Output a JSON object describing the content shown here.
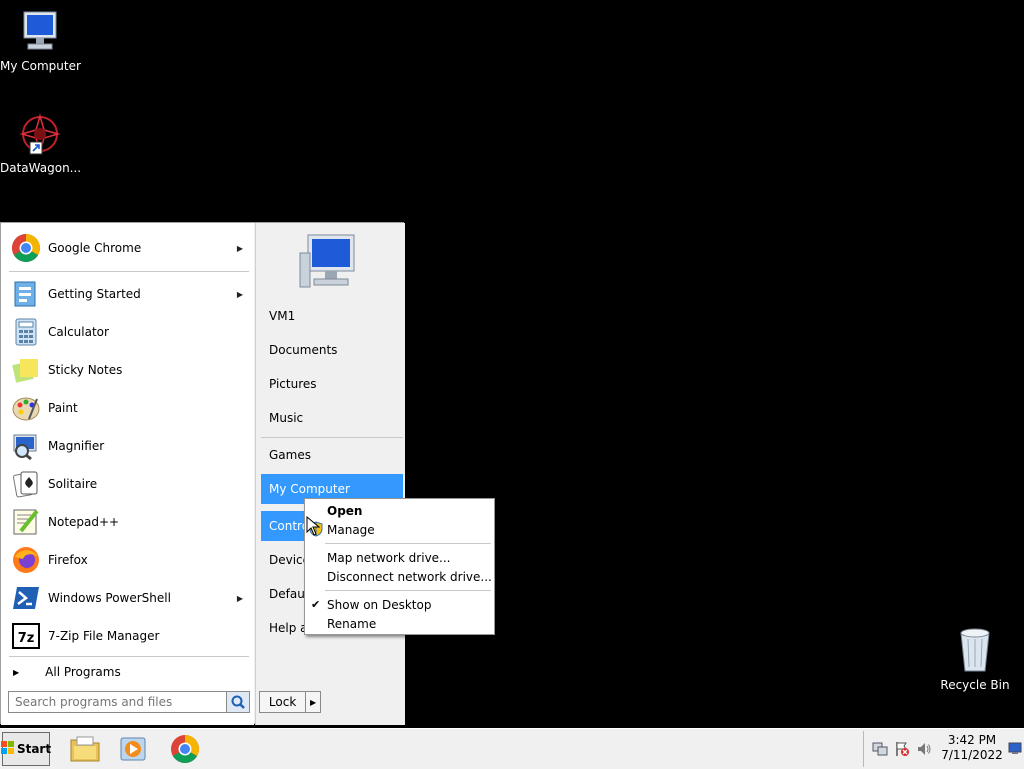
{
  "desktop": {
    "icons": [
      {
        "label": "My Computer",
        "icon": "computer-icon"
      },
      {
        "label": "DataWagon...",
        "icon": "datawagon-icon"
      },
      {
        "label": "Recycle Bin",
        "icon": "recycle-bin-icon"
      }
    ]
  },
  "start_menu": {
    "pinned": [
      {
        "label": "Google Chrome",
        "icon": "chrome-icon",
        "has_submenu": true
      }
    ],
    "recent": [
      {
        "label": "Getting Started",
        "icon": "getting-started-icon",
        "has_submenu": true
      },
      {
        "label": "Calculator",
        "icon": "calculator-icon",
        "has_submenu": false
      },
      {
        "label": "Sticky Notes",
        "icon": "sticky-notes-icon",
        "has_submenu": false
      },
      {
        "label": "Paint",
        "icon": "paint-icon",
        "has_submenu": false
      },
      {
        "label": "Magnifier",
        "icon": "magnifier-icon",
        "has_submenu": false
      },
      {
        "label": "Solitaire",
        "icon": "solitaire-icon",
        "has_submenu": false
      },
      {
        "label": "Notepad++",
        "icon": "notepadpp-icon",
        "has_submenu": false
      },
      {
        "label": "Firefox",
        "icon": "firefox-icon",
        "has_submenu": false
      },
      {
        "label": "Windows PowerShell",
        "icon": "powershell-icon",
        "has_submenu": true
      },
      {
        "label": "7-Zip File Manager",
        "icon": "7zip-icon",
        "has_submenu": false
      }
    ],
    "all_programs": "All Programs",
    "search_placeholder": "Search programs and files",
    "right_pane": [
      {
        "label": "VM1"
      },
      {
        "label": "Documents"
      },
      {
        "label": "Pictures"
      },
      {
        "label": "Music"
      },
      {
        "label": "Games"
      },
      {
        "label": "My Computer",
        "highlighted": true
      },
      {
        "label": "Contro",
        "highlighted": true
      },
      {
        "label": "Devices"
      },
      {
        "label": "Default"
      },
      {
        "label": "Help ar"
      }
    ],
    "lock_label": "Lock"
  },
  "context_menu": {
    "items": [
      {
        "label": "Open",
        "bold": true
      },
      {
        "label": "Manage"
      },
      {
        "label": "Map network drive..."
      },
      {
        "label": "Disconnect network drive..."
      },
      {
        "label": "Show on Desktop",
        "checked": true
      },
      {
        "label": "Rename"
      }
    ]
  },
  "taskbar": {
    "start_label": "Start",
    "apps": [
      "file-explorer-icon",
      "media-player-icon",
      "chrome-icon"
    ],
    "clock": {
      "time": "3:42 PM",
      "date": "7/11/2022"
    }
  },
  "colors": {
    "highlight": "#3399ff",
    "desktop": "#000000",
    "menu": "#f0f0f0"
  }
}
